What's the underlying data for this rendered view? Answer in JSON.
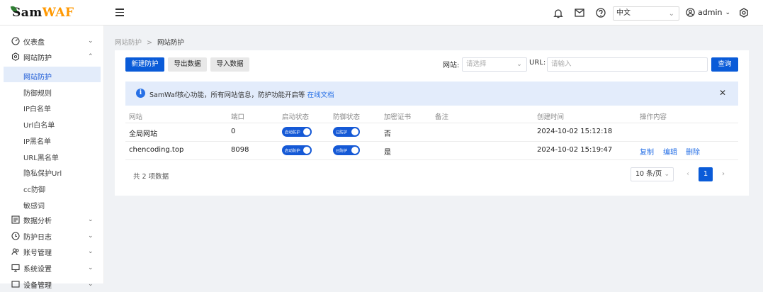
{
  "app": {
    "logo_prefix": "Sam",
    "logo_suffix": "WAF"
  },
  "header": {
    "language": "中文",
    "user": "admin",
    "icons": [
      "bell-icon",
      "mail-icon",
      "help-icon",
      "user-icon",
      "settings-icon"
    ]
  },
  "sidebar": {
    "items": [
      {
        "label": "仪表盘",
        "icon": "dashboard-icon"
      },
      {
        "label": "网站防护",
        "icon": "shield-icon"
      },
      {
        "label": "数据分析",
        "icon": "analysis-icon"
      },
      {
        "label": "防护日志",
        "icon": "log-icon"
      },
      {
        "label": "账号管理",
        "icon": "users-icon"
      },
      {
        "label": "系统设置",
        "icon": "system-icon"
      },
      {
        "label": "设备管理",
        "icon": "device-icon"
      }
    ],
    "subitems": [
      "网站防护",
      "防御规则",
      "IP白名单",
      "Url白名单",
      "IP黑名单",
      "URL黑名单",
      "隐私保护Url",
      "cc防御",
      "敏感词"
    ]
  },
  "breadcrumb": {
    "parent": "网站防护",
    "separator": ">",
    "current": "网站防护"
  },
  "toolbar": {
    "new_label": "新建防护",
    "export_label": "导出数据",
    "import_label": "导入数据",
    "site_label": "网站:",
    "site_placeholder": "请选择",
    "url_label": "URL:",
    "url_placeholder": "请输入",
    "query_label": "查询"
  },
  "alert": {
    "message": "SamWaf核心功能，所有网站信息，防护功能开启等",
    "link": "在线文档"
  },
  "table": {
    "headers": [
      "网站",
      "端口",
      "启动状态",
      "防御状态",
      "加密证书",
      "备注",
      "创建时间",
      "操作内容"
    ],
    "rows": [
      {
        "site": "全局网站",
        "port": "0",
        "start_status": "启动防护",
        "defense_status": "已防护",
        "ssl": "否",
        "remark": "",
        "created": "2024-10-02 15:12:18",
        "actions": []
      },
      {
        "site": "chencoding.top",
        "port": "8098",
        "start_status": "启动防护",
        "defense_status": "已防护",
        "ssl": "是",
        "remark": "",
        "created": "2024-10-02 15:19:47",
        "actions": [
          "复制",
          "编辑",
          "删除"
        ]
      }
    ]
  },
  "pagination": {
    "total": "共 2 项数据",
    "page_size": "10 条/页",
    "current_page": "1",
    "prev": "‹",
    "next": "›"
  },
  "colors": {
    "primary": "#0a5bd8",
    "link": "#2770e6",
    "alert_bg": "#e3ecfb"
  }
}
